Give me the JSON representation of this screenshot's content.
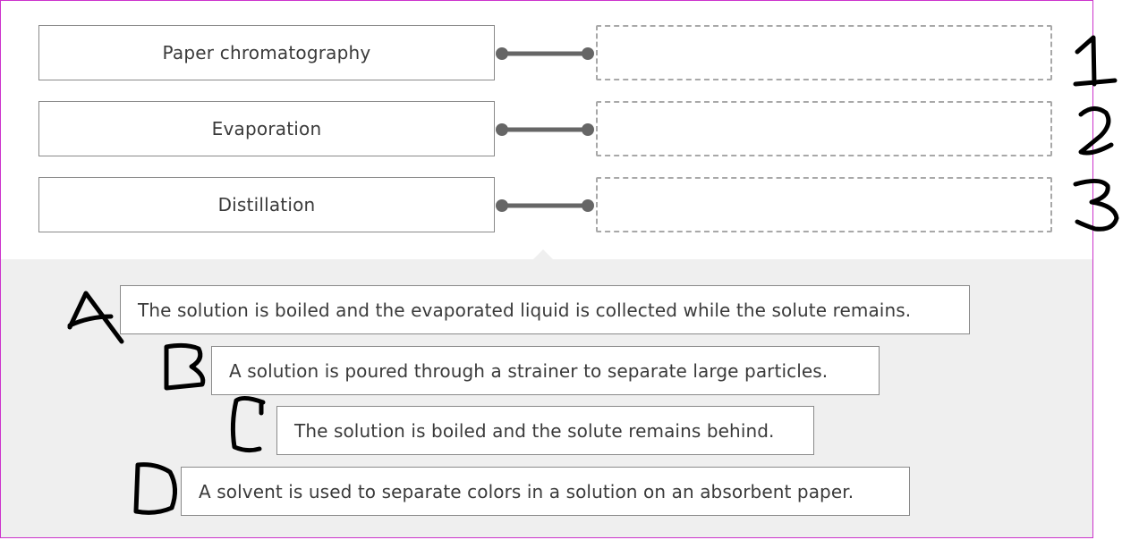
{
  "terms": [
    {
      "label": "Paper chromatography"
    },
    {
      "label": "Evaporation"
    },
    {
      "label": "Distillation"
    }
  ],
  "options": [
    {
      "text": "The solution is boiled and the evaporated liquid is collected while the solute remains."
    },
    {
      "text": "A solution is poured through a strainer to separate large particles."
    },
    {
      "text": "The solution is boiled and the solute remains behind."
    },
    {
      "text": "A solvent is used to separate colors in a solution on an absorbent paper."
    }
  ],
  "annotations": {
    "numbers": [
      "1",
      "2",
      "3"
    ],
    "letters": [
      "A",
      "B",
      "C",
      "D"
    ]
  },
  "colors": {
    "connector": "#666666",
    "frame": "#cc33cc",
    "tray": "#efefef"
  }
}
